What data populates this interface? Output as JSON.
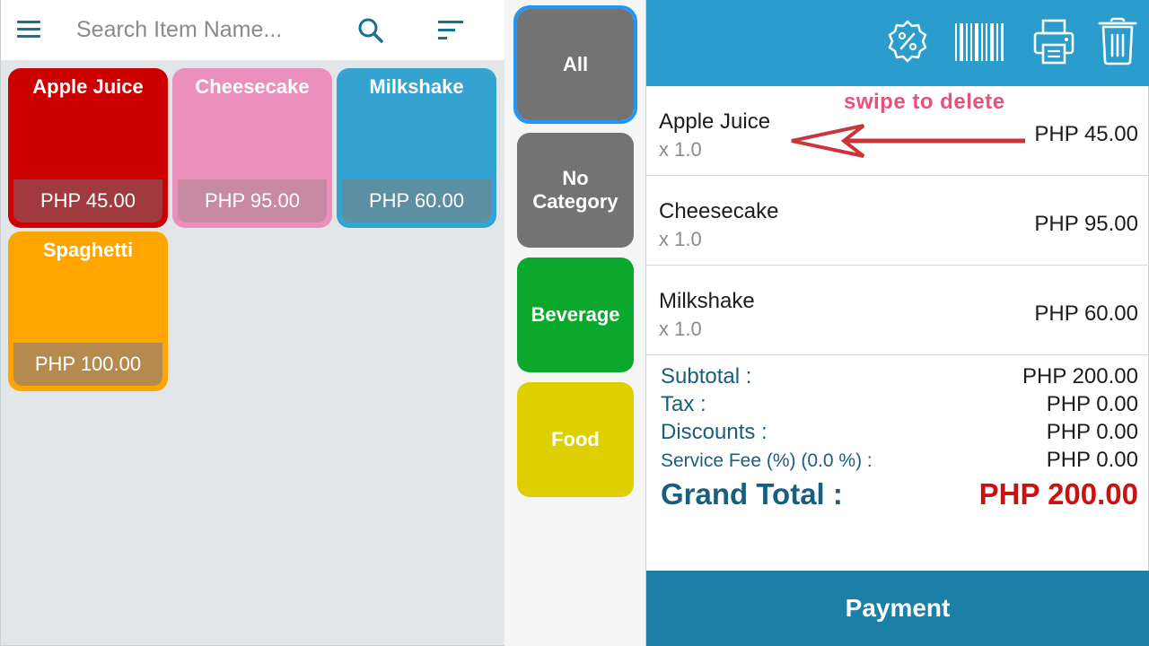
{
  "search": {
    "placeholder": "Search Item Name...",
    "value": ""
  },
  "items": [
    {
      "name": "Apple Juice",
      "price": "PHP 45.00",
      "color": "#cc0000",
      "price_bg": "#a03a3f"
    },
    {
      "name": "Cheesecake",
      "price": "PHP 95.00",
      "color": "#eb8fbc",
      "price_bg": "#c78aa2"
    },
    {
      "name": "Milkshake",
      "price": "PHP 60.00",
      "color": "#35a3cf",
      "price_bg": "#5d8fa2"
    },
    {
      "name": "Spaghetti",
      "price": "PHP 100.00",
      "color": "#ffa500",
      "price_bg": "#b48a4e"
    }
  ],
  "categories": [
    {
      "label": "All",
      "color": "#737373",
      "active": true
    },
    {
      "label": "No Category",
      "color": "#737373",
      "active": false
    },
    {
      "label": "Beverage",
      "color": "#0aa82d",
      "active": false
    },
    {
      "label": "Food",
      "color": "#ddcf00",
      "active": false
    }
  ],
  "toolbar": {
    "icons": [
      "discount-icon",
      "barcode-icon",
      "printer-icon",
      "trash-icon"
    ],
    "color": "#2a9dcc"
  },
  "order": {
    "hint": "swipe to delete",
    "lines": [
      {
        "name": "Apple Juice",
        "qty": "x 1.0",
        "price": "PHP 45.00"
      },
      {
        "name": "Cheesecake",
        "qty": "x 1.0",
        "price": "PHP 95.00"
      },
      {
        "name": "Milkshake",
        "qty": "x 1.0",
        "price": "PHP 60.00"
      }
    ]
  },
  "totals": {
    "subtotal_label": "Subtotal :",
    "subtotal_value": "PHP 200.00",
    "tax_label": "Tax :",
    "tax_value": "PHP 0.00",
    "discounts_label": "Discounts :",
    "discounts_value": "PHP 0.00",
    "service_fee_label": "Service Fee (%) (0.0 %) :",
    "service_fee_value": "PHP 0.00",
    "grand_total_label": "Grand Total :",
    "grand_total_value": "PHP 200.00"
  },
  "payment_label": "Payment"
}
